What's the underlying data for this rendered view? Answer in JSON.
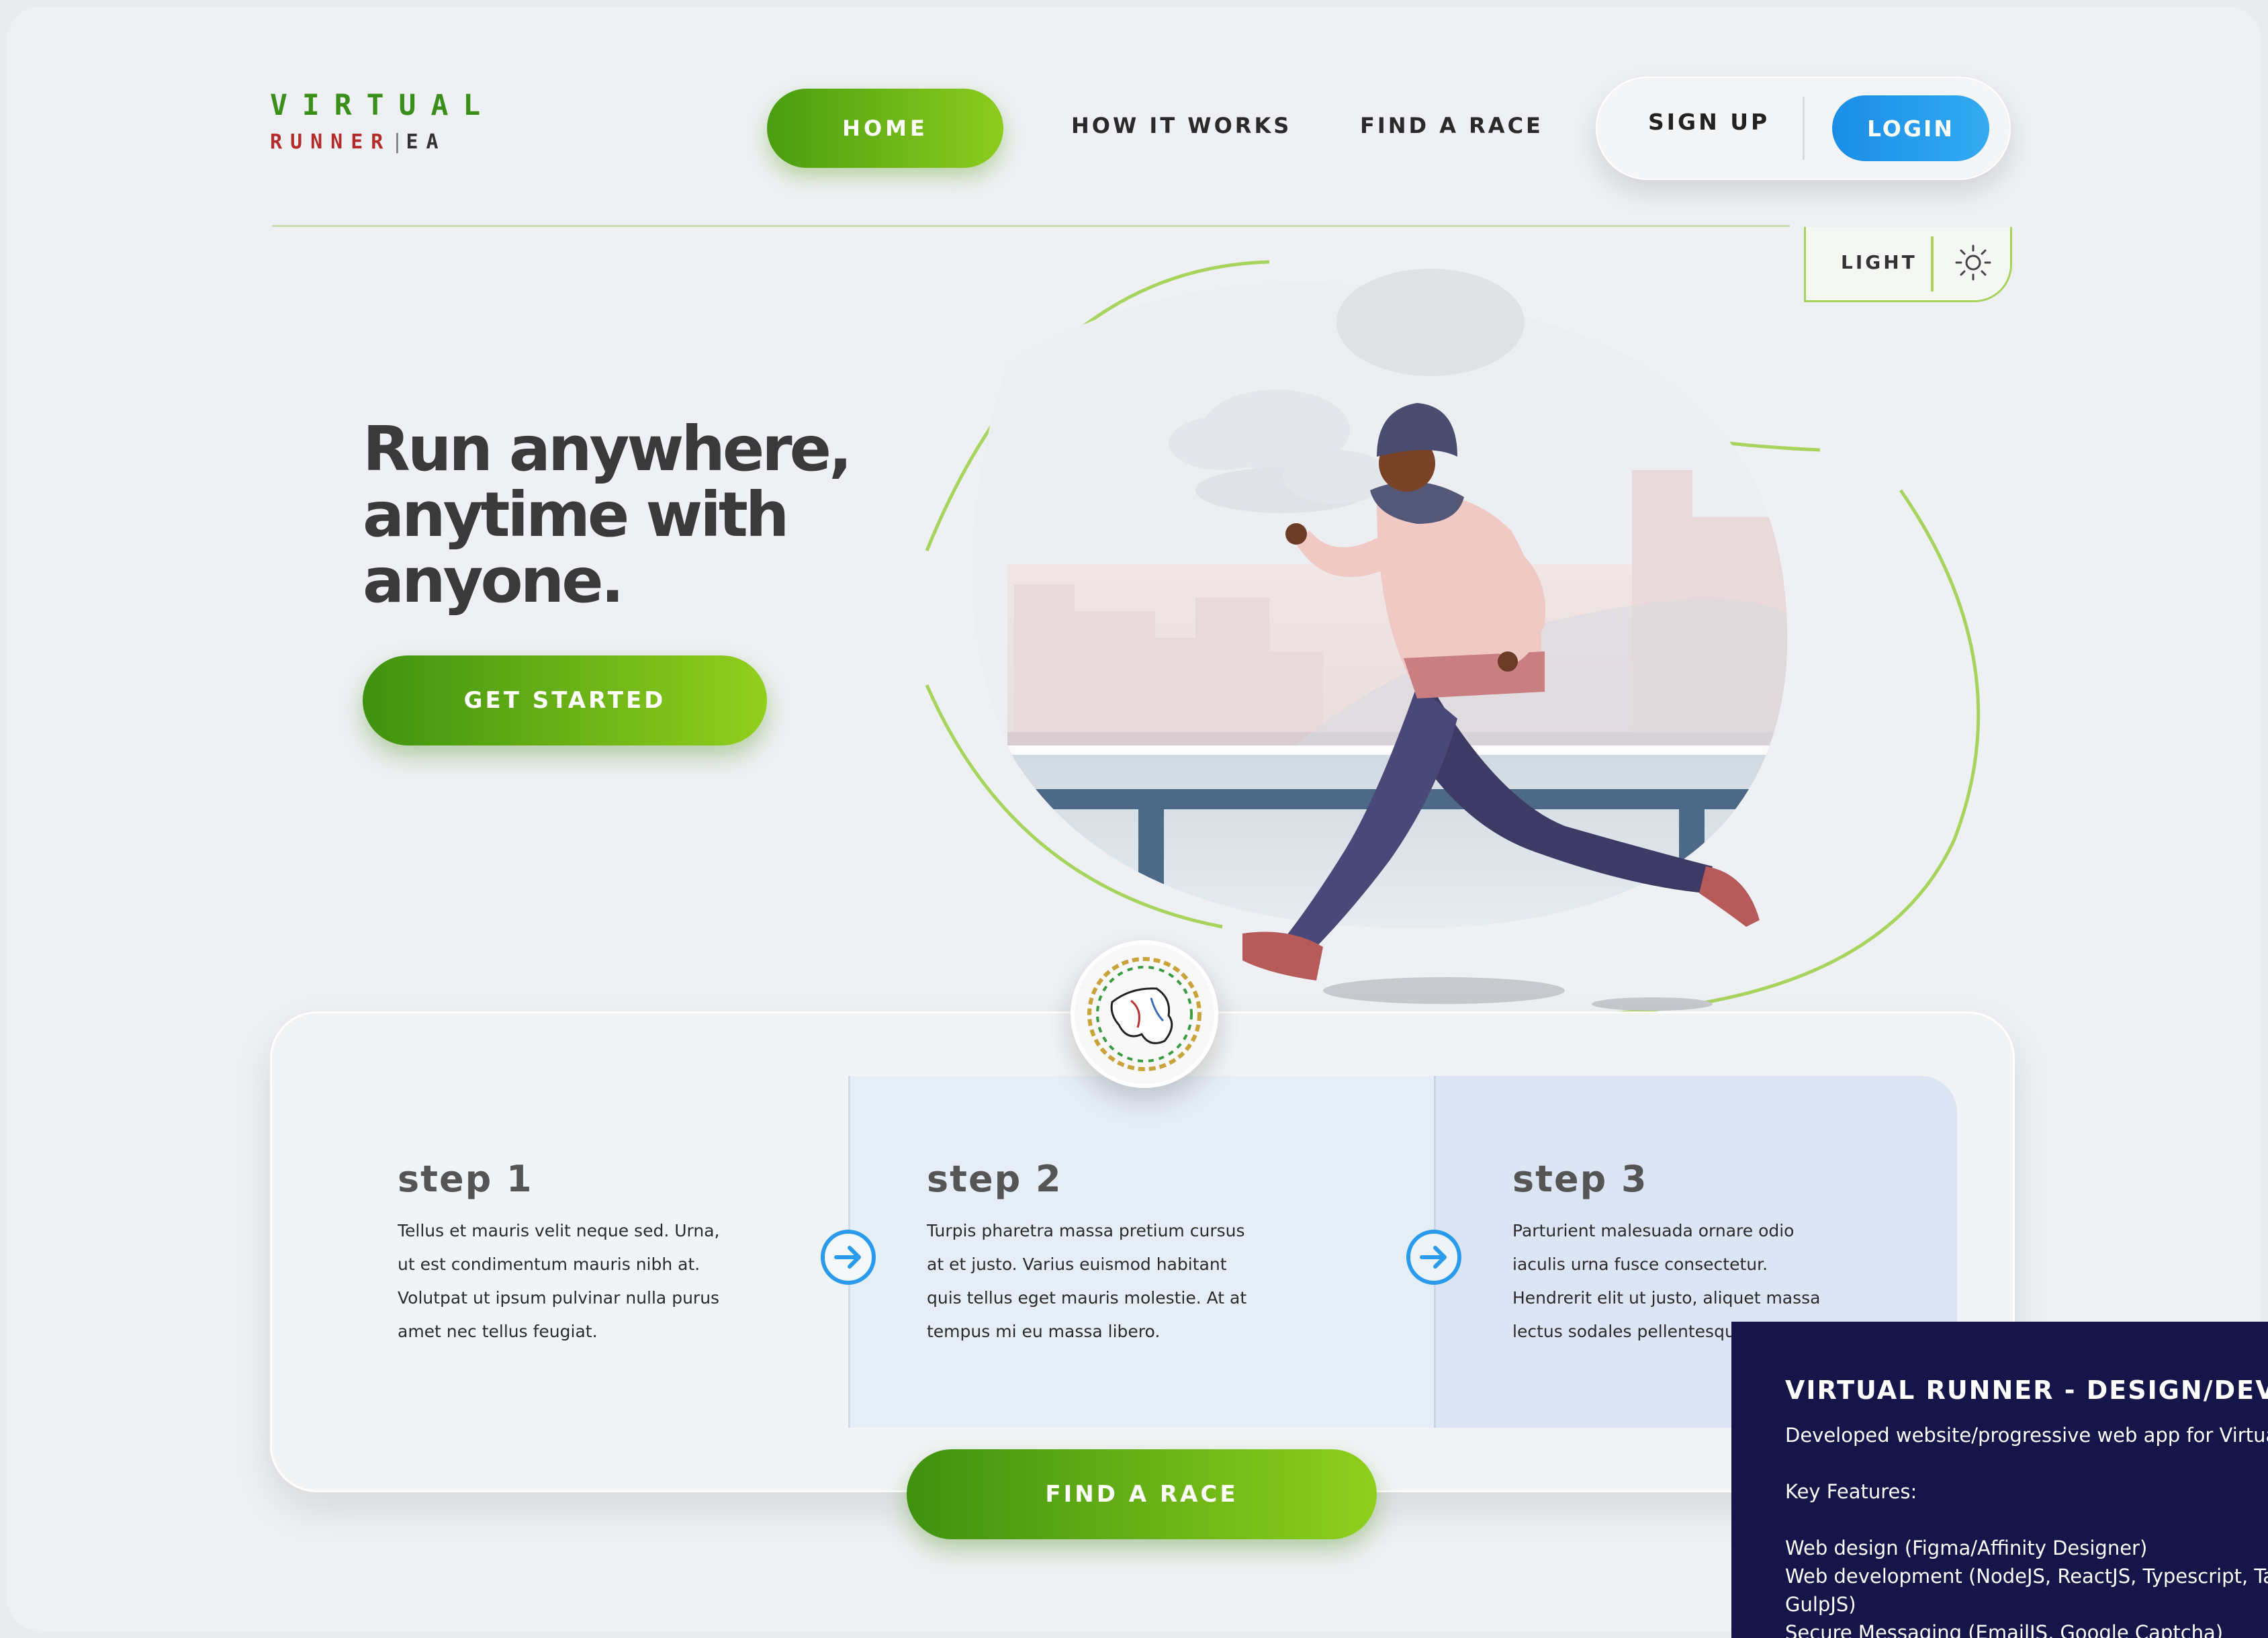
{
  "brand": {
    "line1": "VIRTUAL",
    "line2_a": "RUNNER",
    "line2_sep": "|",
    "line2_b": "EA"
  },
  "nav": {
    "home": "HOME",
    "how": "HOW IT WORKS",
    "find": "FIND A RACE"
  },
  "auth": {
    "signup": "SIGN UP",
    "login": "LOGIN"
  },
  "theme": {
    "label": "LIGHT"
  },
  "hero": {
    "title_line1": "Run anywhere,",
    "title_line2": "anytime with",
    "title_line3": "anyone.",
    "cta": "GET STARTED"
  },
  "steps": [
    {
      "title": "step 1",
      "text": "Tellus et mauris velit neque sed. Urna, ut est condimentum mauris nibh at. Volutpat ut ipsum pulvinar nulla purus amet nec tellus feugiat."
    },
    {
      "title": "step 2",
      "text": "Turpis pharetra massa pretium cursus at et justo. Varius euismod habitant quis tellus eget mauris molestie. At at tempus mi eu massa libero."
    },
    {
      "title": "step 3",
      "text": "Parturient malesuada ornare odio iaculis urna fusce consectetur. Hendrerit elit ut justo, aliquet massa lectus sodales pellentesque neque."
    }
  ],
  "find_race": "FIND A RACE",
  "info": {
    "title": "VIRTUAL RUNNER - DESIGN/DEVELO",
    "intro": "Developed website/progressive web app for Virtual",
    "features_label": "Key Features:",
    "feature1": "Web design (Figma/Affinity Designer)",
    "feature2": "Web development (NodeJS, ReactJS, Typescript, Tai",
    "feature3": "GulpJS)",
    "feature4": "Secure Messaging (EmailJS, Google Captcha)"
  },
  "colors": {
    "accent_green": "#7cc41c",
    "accent_blue": "#1f94ea",
    "panel_navy": "#15154a"
  }
}
